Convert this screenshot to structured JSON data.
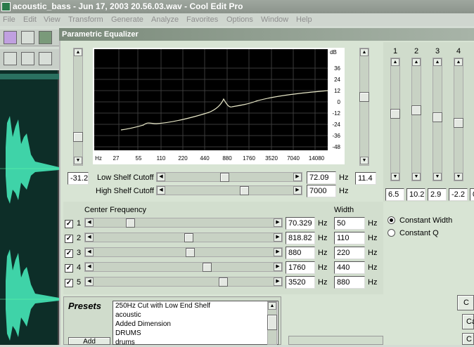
{
  "app": {
    "title": "acoustic_bass - Jun 17, 2003 20.56.03.wav - Cool Edit Pro"
  },
  "menu": [
    "File",
    "Edit",
    "View",
    "Transform",
    "Generate",
    "Analyze",
    "Favorites",
    "Options",
    "Window",
    "Help"
  ],
  "dialog": {
    "title": "Parametric Equalizer"
  },
  "graph": {
    "db_label": "dB",
    "db_ticks": [
      "36",
      "24",
      "12",
      "0",
      "-12",
      "-24",
      "-36",
      "-48"
    ],
    "hz_ticks": [
      "Hz",
      "27",
      "55",
      "110",
      "220",
      "440",
      "880",
      "1760",
      "3520",
      "7040",
      "14080"
    ]
  },
  "master": {
    "gain_value": "-31.2",
    "right_value": "11.4"
  },
  "shelf": {
    "low_label": "Low Shelf Cutoff",
    "low_value": "72.09",
    "high_label": "High Shelf Cutoff",
    "high_value": "7000",
    "unit": "Hz"
  },
  "bands": {
    "col_labels": [
      "1",
      "2",
      "3",
      "4"
    ],
    "values": [
      "6.5",
      "10.2",
      "2.9",
      "-2.2",
      "0"
    ]
  },
  "center": {
    "label": "Center Frequency",
    "width_label": "Width",
    "rows": [
      {
        "num": "1",
        "freq": "70.329",
        "width": "50"
      },
      {
        "num": "2",
        "freq": "818.82",
        "width": "110"
      },
      {
        "num": "3",
        "freq": "880",
        "width": "220"
      },
      {
        "num": "4",
        "freq": "1760",
        "width": "440"
      },
      {
        "num": "5",
        "freq": "3520",
        "width": "880"
      }
    ],
    "unit": "Hz"
  },
  "options": {
    "constant_width": "Constant Width",
    "constant_q": "Constant Q"
  },
  "presets": {
    "label": "Presets",
    "items": [
      "250Hz Cut with Low End Shelf",
      "acoustic",
      "Added Dimension",
      "DRUMS",
      "drums"
    ],
    "add_label": "Add"
  },
  "side_buttons": [
    "C",
    "Ca",
    "C"
  ]
}
